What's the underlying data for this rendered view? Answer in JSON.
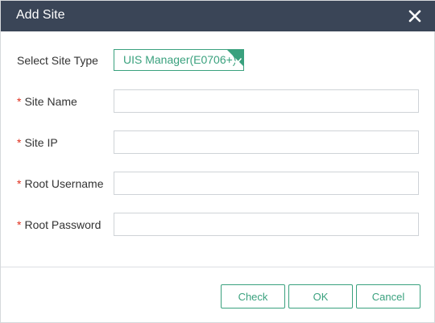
{
  "dialog": {
    "title": "Add Site"
  },
  "form": {
    "site_type": {
      "label": "Select Site Type",
      "value": "UIS Manager(E0706+)"
    },
    "site_name": {
      "required_mark": "*",
      "label": "Site Name",
      "value": ""
    },
    "site_ip": {
      "required_mark": "*",
      "label": "Site IP",
      "value": ""
    },
    "root_username": {
      "required_mark": "*",
      "label": "Root Username",
      "value": ""
    },
    "root_password": {
      "required_mark": "*",
      "label": "Root Password",
      "value": ""
    }
  },
  "footer": {
    "check_label": "Check",
    "ok_label": "OK",
    "cancel_label": "Cancel"
  },
  "icons": {
    "close": "close-icon",
    "check": "checkmark-icon"
  },
  "colors": {
    "titlebar": "#3a4557",
    "accent": "#3aa17e",
    "required": "#e0301e"
  }
}
